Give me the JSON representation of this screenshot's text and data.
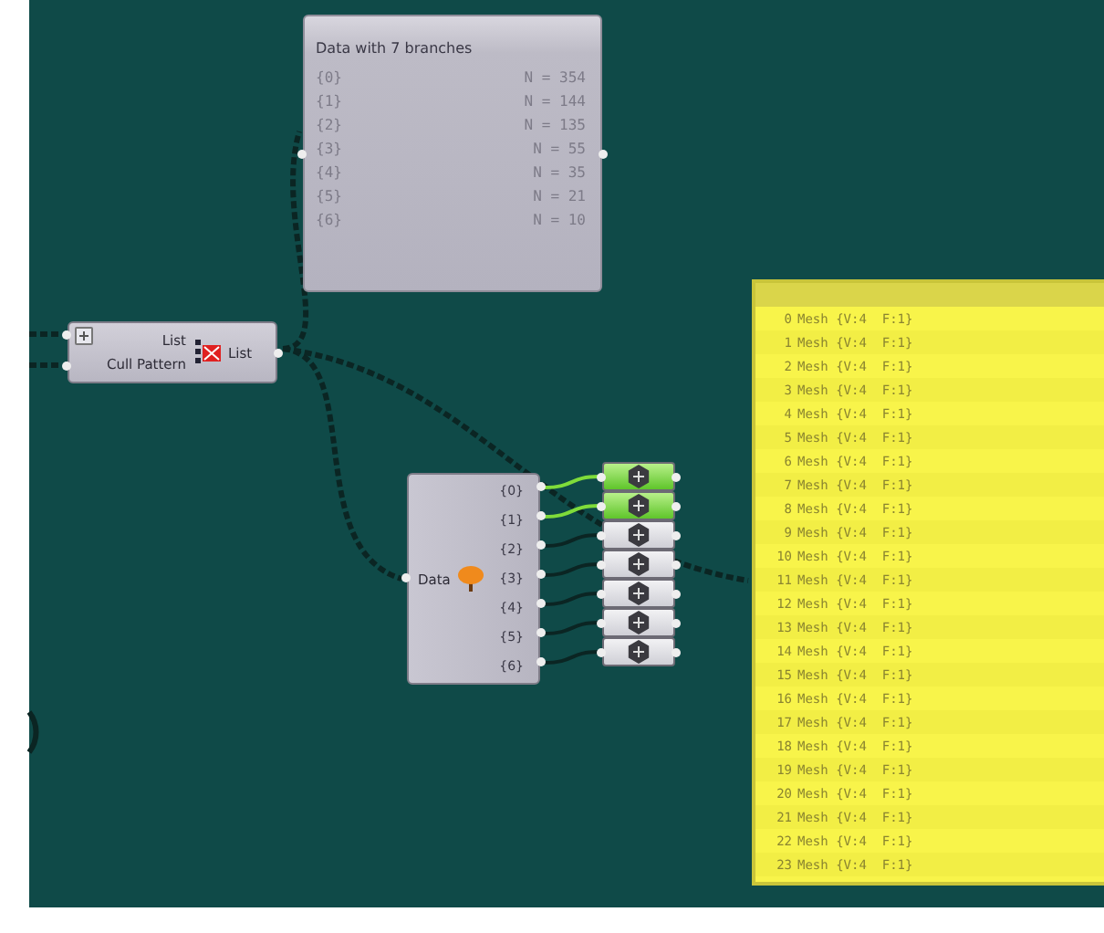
{
  "data_panel": {
    "title": "Data with 7 branches",
    "rows": [
      {
        "path": "{0}",
        "count": "N = 354"
      },
      {
        "path": "{1}",
        "count": "N = 144"
      },
      {
        "path": "{2}",
        "count": "N = 135"
      },
      {
        "path": "{3}",
        "count": "N = 55"
      },
      {
        "path": "{4}",
        "count": "N = 35"
      },
      {
        "path": "{5}",
        "count": "N = 21"
      },
      {
        "path": "{6}",
        "count": "N = 10"
      }
    ]
  },
  "cull_node": {
    "inputs": [
      "List",
      "Cull Pattern"
    ],
    "output": "List"
  },
  "explode_node": {
    "input": "Data",
    "outputs": [
      "{0}",
      "{1}",
      "{2}",
      "{3}",
      "{4}",
      "{5}",
      "{6}"
    ]
  },
  "preview_nodes": [
    {
      "selected": true
    },
    {
      "selected": true
    },
    {
      "selected": false
    },
    {
      "selected": false
    },
    {
      "selected": false
    },
    {
      "selected": false
    },
    {
      "selected": false
    }
  ],
  "mesh_panel": {
    "rows": [
      {
        "index": "0",
        "value": "Mesh {V:4  F:1}"
      },
      {
        "index": "1",
        "value": "Mesh {V:4  F:1}"
      },
      {
        "index": "2",
        "value": "Mesh {V:4  F:1}"
      },
      {
        "index": "3",
        "value": "Mesh {V:4  F:1}"
      },
      {
        "index": "4",
        "value": "Mesh {V:4  F:1}"
      },
      {
        "index": "5",
        "value": "Mesh {V:4  F:1}"
      },
      {
        "index": "6",
        "value": "Mesh {V:4  F:1}"
      },
      {
        "index": "7",
        "value": "Mesh {V:4  F:1}"
      },
      {
        "index": "8",
        "value": "Mesh {V:4  F:1}"
      },
      {
        "index": "9",
        "value": "Mesh {V:4  F:1}"
      },
      {
        "index": "10",
        "value": "Mesh {V:4  F:1}"
      },
      {
        "index": "11",
        "value": "Mesh {V:4  F:1}"
      },
      {
        "index": "12",
        "value": "Mesh {V:4  F:1}"
      },
      {
        "index": "13",
        "value": "Mesh {V:4  F:1}"
      },
      {
        "index": "14",
        "value": "Mesh {V:4  F:1}"
      },
      {
        "index": "15",
        "value": "Mesh {V:4  F:1}"
      },
      {
        "index": "16",
        "value": "Mesh {V:4  F:1}"
      },
      {
        "index": "17",
        "value": "Mesh {V:4  F:1}"
      },
      {
        "index": "18",
        "value": "Mesh {V:4  F:1}"
      },
      {
        "index": "19",
        "value": "Mesh {V:4  F:1}"
      },
      {
        "index": "20",
        "value": "Mesh {V:4  F:1}"
      },
      {
        "index": "21",
        "value": "Mesh {V:4  F:1}"
      },
      {
        "index": "22",
        "value": "Mesh {V:4  F:1}"
      },
      {
        "index": "23",
        "value": "Mesh {V:4  F:1}"
      }
    ]
  }
}
